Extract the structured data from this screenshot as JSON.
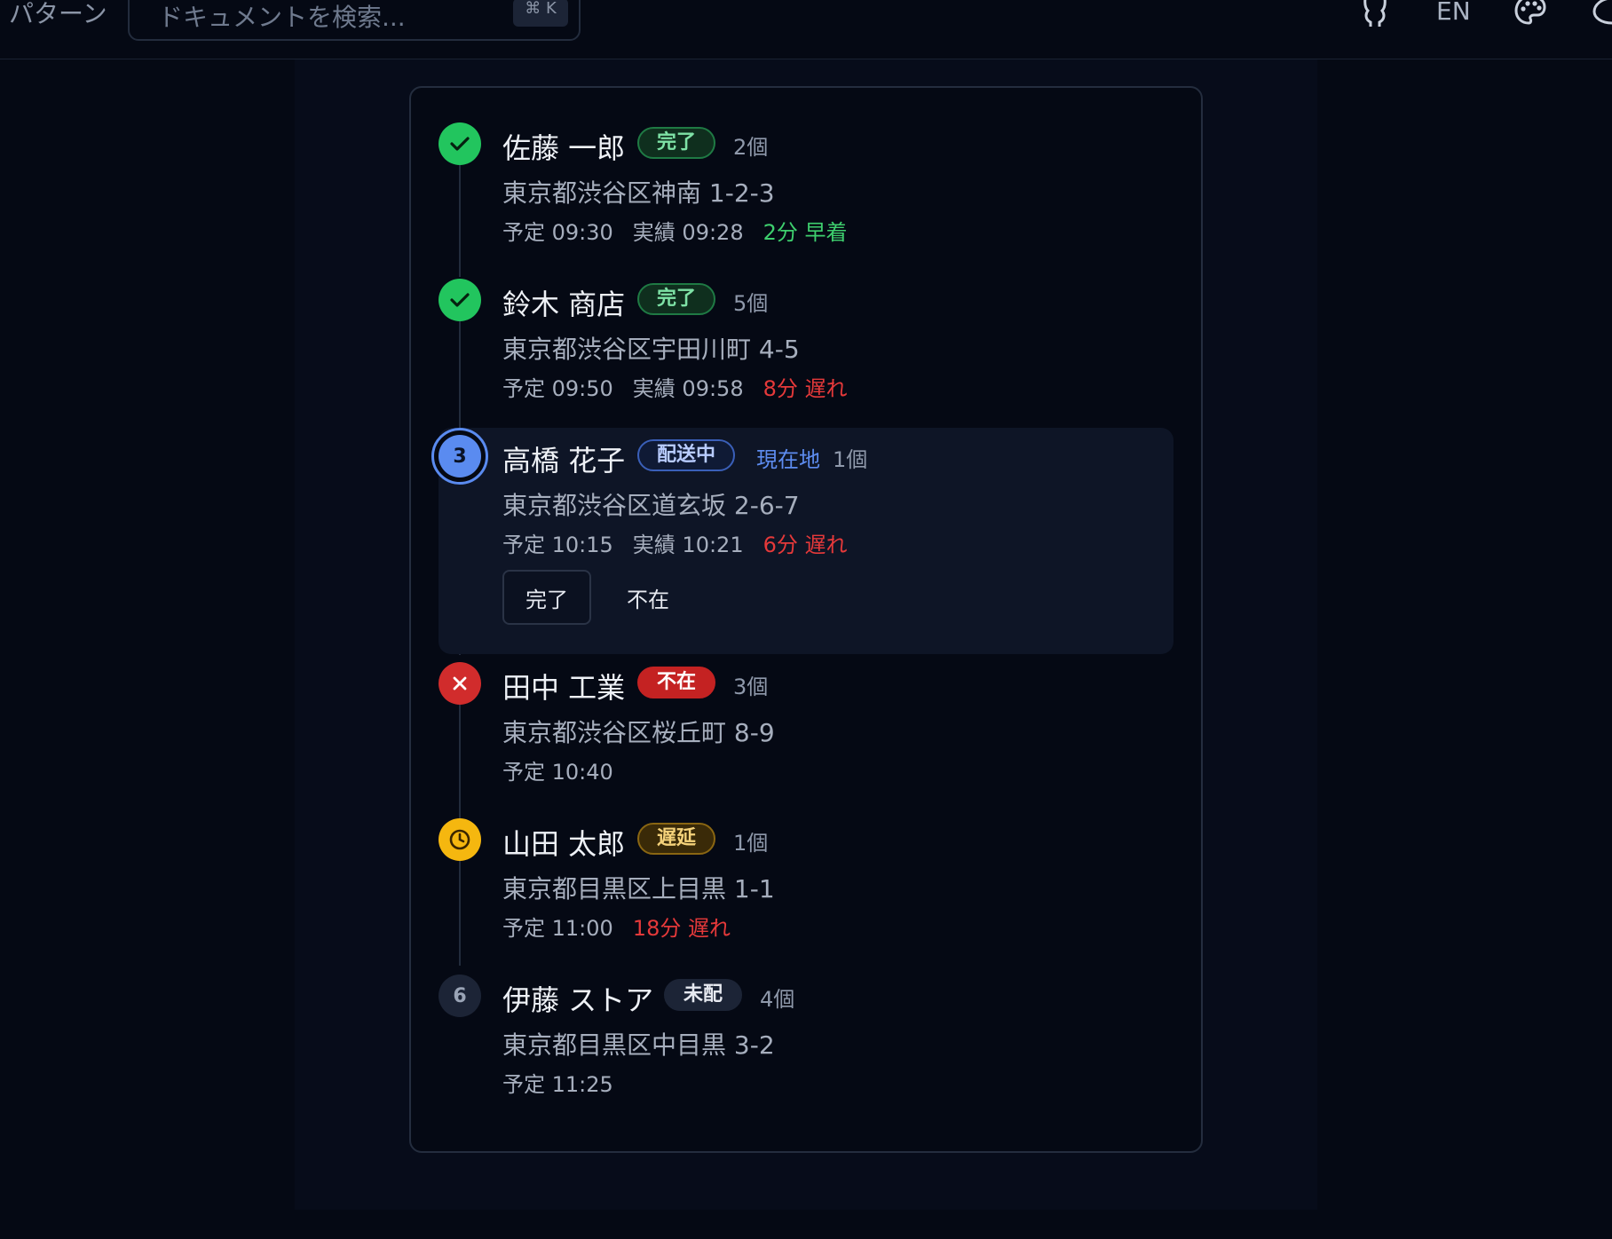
{
  "header": {
    "nav_label": "パターン",
    "search_placeholder": "ドキュメントを検索...",
    "search_shortcut": "⌘ K",
    "github_icon": "github-icon",
    "language": "EN",
    "theme_icon": "palette-icon",
    "mode_icon": "moon-icon"
  },
  "colors": {
    "done": "#22c55e",
    "absent": "#d12c2c",
    "delayed": "#f5b70f",
    "current": "#5a8bf0",
    "early_text": "#3ecf6e",
    "late_text": "#e5393a"
  },
  "stops": [
    {
      "status": "done",
      "marker": "check-icon",
      "name": "佐藤 一郎",
      "badge": "完了",
      "qty": "2個",
      "address": "東京都渋谷区神南 1-2-3",
      "planned": "予定 09:30",
      "actual": "実績 09:28",
      "diff": "2分 早着"
    },
    {
      "status": "done",
      "marker": "check-icon",
      "name": "鈴木 商店",
      "badge": "完了",
      "qty": "5個",
      "address": "東京都渋谷区宇田川町 4-5",
      "planned": "予定 09:50",
      "actual": "実績 09:58",
      "diff": "8分 遅れ"
    },
    {
      "status": "current",
      "marker_number": "3",
      "name": "高橋 花子",
      "badge": "配送中",
      "location_label": "現在地",
      "qty": "1個",
      "address": "東京都渋谷区道玄坂 2-6-7",
      "planned": "予定 10:15",
      "actual": "実績 10:21",
      "diff": "6分 遅れ",
      "actions": {
        "complete": "完了",
        "absent": "不在"
      }
    },
    {
      "status": "absent",
      "marker": "x-icon",
      "name": "田中 工業",
      "badge": "不在",
      "qty": "3個",
      "address": "東京都渋谷区桜丘町 8-9",
      "planned": "予定 10:40"
    },
    {
      "status": "delayed",
      "marker": "clock-icon",
      "name": "山田 太郎",
      "badge": "遅延",
      "qty": "1個",
      "address": "東京都目黒区上目黒 1-1",
      "planned": "予定 11:00",
      "diff": "18分 遅れ"
    },
    {
      "status": "pending",
      "marker_number": "6",
      "name": "伊藤 ストア",
      "badge": "未配",
      "qty": "4個",
      "address": "東京都目黒区中目黒 3-2",
      "planned": "予定 11:25"
    }
  ]
}
